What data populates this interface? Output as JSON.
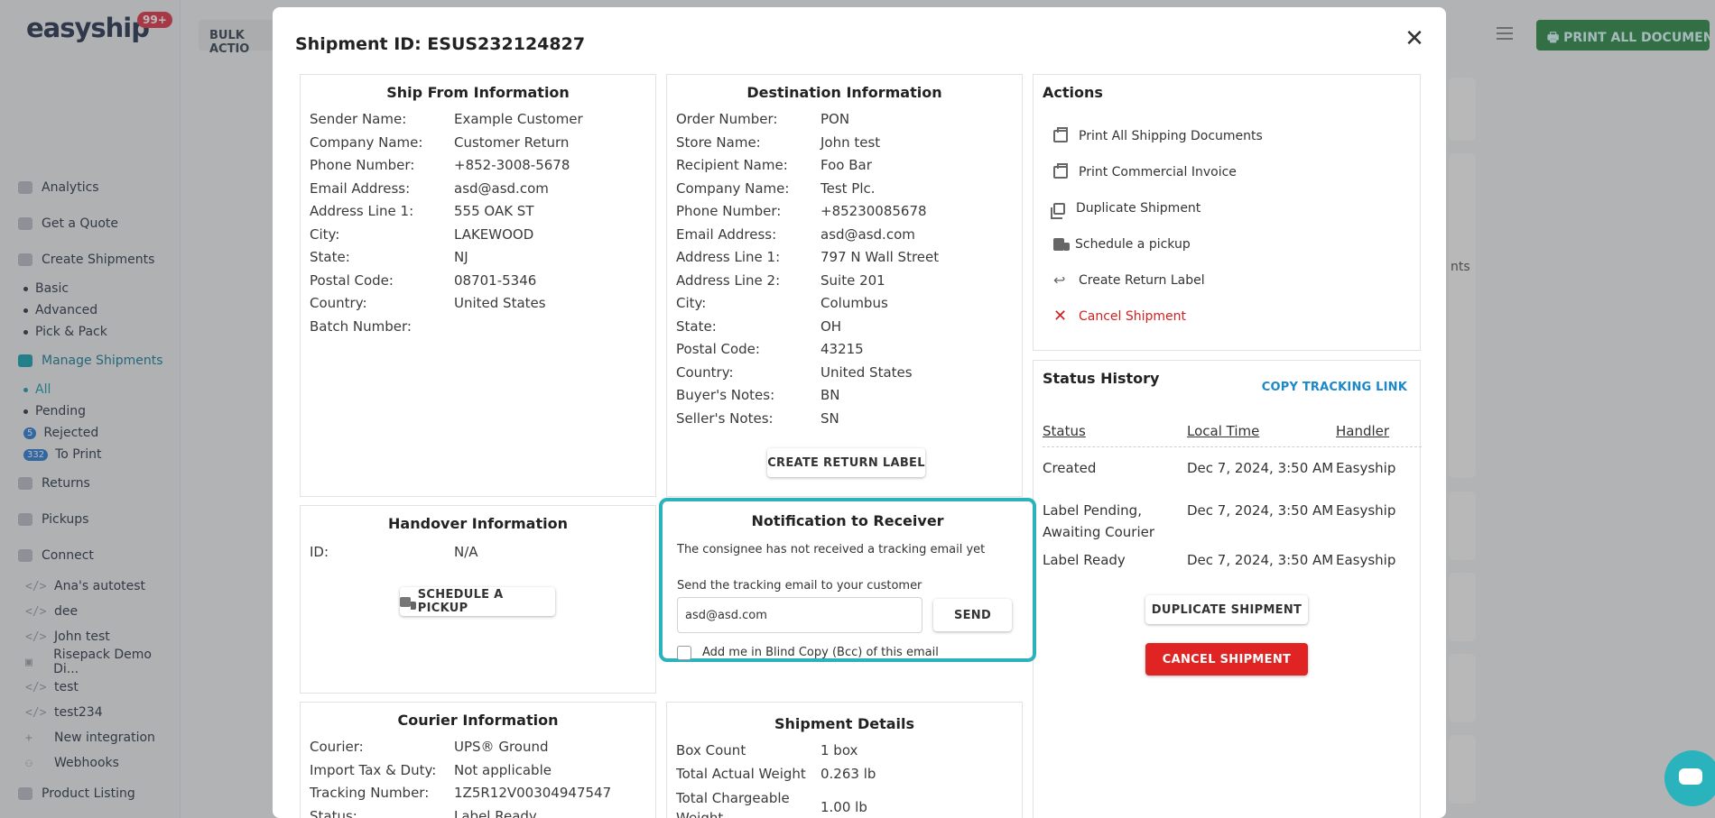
{
  "app": {
    "logo": "easyship",
    "logo_badge": "99+",
    "bulk_label": "BULK ACTIO",
    "print_all_label": "PRINT ALL DOCUMENTS",
    "bg_partial_text": "nts"
  },
  "sidebar": {
    "items": [
      {
        "label": "Analytics",
        "icon": "chart-icon"
      },
      {
        "label": "Get a Quote",
        "icon": "calculator-icon"
      },
      {
        "label": "Create Shipments",
        "icon": "box-icon"
      }
    ],
    "create_sub": [
      "Basic",
      "Advanced",
      "Pick & Pack"
    ],
    "manage": {
      "label": "Manage Shipments",
      "icon": "manage-icon"
    },
    "manage_sub": [
      {
        "label": "All",
        "count": ""
      },
      {
        "label": "Pending",
        "count": ""
      },
      {
        "label": "Rejected",
        "count": "5"
      },
      {
        "label": "To Print",
        "count": "332"
      }
    ],
    "lower_items": [
      {
        "label": "Returns",
        "icon": "returns-icon"
      },
      {
        "label": "Pickups",
        "icon": "truck-icon"
      },
      {
        "label": "Connect",
        "icon": "connect-icon"
      }
    ],
    "integrations": [
      {
        "label": "Ana's autotest",
        "icon": "</>"
      },
      {
        "label": "dee",
        "icon": "</>"
      },
      {
        "label": "John test",
        "icon": "</>"
      },
      {
        "label": "Risepack Demo Di...",
        "icon": "bag"
      },
      {
        "label": "test",
        "icon": "</>"
      },
      {
        "label": "test234",
        "icon": "</>"
      },
      {
        "label": "New integration",
        "icon": "+"
      },
      {
        "label": "Webhooks",
        "icon": "hook"
      }
    ],
    "product_listing": "Product Listing"
  },
  "modal": {
    "title": "Shipment ID: ESUS232124827",
    "ship_from": {
      "heading": "Ship From Information",
      "rows": [
        {
          "k": "Sender Name:",
          "v": "Example Customer"
        },
        {
          "k": "Company Name:",
          "v": "Customer Return"
        },
        {
          "k": "Phone Number:",
          "v": "+852-3008-5678"
        },
        {
          "k": "Email Address:",
          "v": "asd@asd.com"
        },
        {
          "k": "Address Line 1:",
          "v": "555 OAK ST"
        },
        {
          "k": "City:",
          "v": "LAKEWOOD"
        },
        {
          "k": "State:",
          "v": "NJ"
        },
        {
          "k": "Postal Code:",
          "v": "08701-5346"
        },
        {
          "k": "Country:",
          "v": "United States"
        },
        {
          "k": "Batch Number:",
          "v": ""
        }
      ]
    },
    "destination": {
      "heading": "Destination Information",
      "rows": [
        {
          "k": "Order Number:",
          "v": "PON"
        },
        {
          "k": "Store Name:",
          "v": "John test"
        },
        {
          "k": "Recipient Name:",
          "v": "Foo Bar"
        },
        {
          "k": "Company Name:",
          "v": "Test Plc."
        },
        {
          "k": "Phone Number:",
          "v": "+85230085678"
        },
        {
          "k": "Email Address:",
          "v": "asd@asd.com"
        },
        {
          "k": "Address Line 1:",
          "v": "797 N Wall Street"
        },
        {
          "k": "Address Line 2:",
          "v": "Suite 201"
        },
        {
          "k": "City:",
          "v": "Columbus"
        },
        {
          "k": "State:",
          "v": "OH"
        },
        {
          "k": "Postal Code:",
          "v": "43215"
        },
        {
          "k": "Country:",
          "v": "United States"
        },
        {
          "k": "Buyer's Notes:",
          "v": "BN"
        },
        {
          "k": "Seller's Notes:",
          "v": "SN"
        }
      ],
      "button": "CREATE RETURN LABEL"
    },
    "actions": {
      "heading": "Actions",
      "items": [
        {
          "label": "Print All Shipping Documents",
          "icon": "printer-icon"
        },
        {
          "label": "Print Commercial Invoice",
          "icon": "printer-icon"
        },
        {
          "label": "Duplicate Shipment",
          "icon": "copy-icon"
        },
        {
          "label": "Schedule a pickup",
          "icon": "truck-icon"
        },
        {
          "label": "Create Return Label",
          "icon": "return-icon"
        },
        {
          "label": "Cancel Shipment",
          "icon": "close-icon"
        }
      ]
    },
    "handover": {
      "heading": "Handover Information",
      "rows": [
        {
          "k": "ID:",
          "v": "N/A"
        }
      ],
      "button": "SCHEDULE A PICKUP"
    },
    "notification": {
      "heading": "Notification to Receiver",
      "status_text": "The consignee has not received a tracking email yet",
      "prompt": "Send the tracking email to your customer",
      "email_value": "asd@asd.com",
      "send_label": "SEND",
      "bcc_label": "Add me in Blind Copy (Bcc) of this email"
    },
    "status_history": {
      "heading": "Status History",
      "copy_link": "COPY TRACKING LINK",
      "columns": [
        "Status",
        "Local Time",
        "Handler"
      ],
      "rows": [
        {
          "status": "Created",
          "time": "Dec 7, 2024, 3:50 AM",
          "handler": "Easyship"
        },
        {
          "status": "Label Pending, Awaiting Courier",
          "time": "Dec 7, 2024, 3:50 AM",
          "handler": "Easyship"
        },
        {
          "status": "Label Ready",
          "time": "Dec 7, 2024, 3:50 AM",
          "handler": "Easyship"
        }
      ],
      "duplicate_btn": "DUPLICATE SHIPMENT",
      "cancel_btn": "CANCEL SHIPMENT"
    },
    "courier": {
      "heading": "Courier Information",
      "rows": [
        {
          "k": "Courier:",
          "v": "UPS® Ground"
        },
        {
          "k": "Import Tax & Duty:",
          "v": "Not applicable"
        },
        {
          "k": "Tracking Number:",
          "v": "1Z5R12V00304947547"
        },
        {
          "k": "Status:",
          "v": "Label Ready"
        }
      ]
    },
    "shipment_details": {
      "heading": "Shipment Details",
      "rows": [
        {
          "k": "Box Count",
          "v": "1 box"
        },
        {
          "k": "Total Actual Weight",
          "v": "0.263 lb"
        },
        {
          "k": "Total Chargeable Weight",
          "v": "1.00 lb"
        }
      ]
    }
  },
  "colors": {
    "brand_navy": "#283654",
    "accent_teal": "#2bb3bd",
    "danger_red": "#e02424",
    "link_blue": "#1a88c9",
    "print_green": "#2e8a4a"
  }
}
